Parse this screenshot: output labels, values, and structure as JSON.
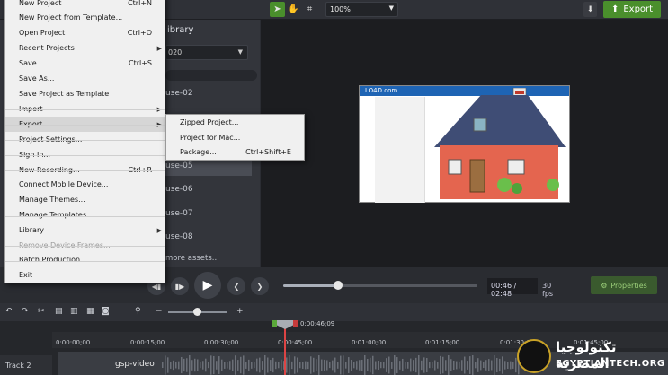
{
  "toolbar": {
    "zoom_value": "100%",
    "export_label": "Export"
  },
  "library": {
    "title": "Library",
    "title_visible": "ibrary",
    "select_value": "020",
    "items": [
      "use-02",
      "use-05",
      "use-06",
      "use-07",
      "use-08"
    ],
    "more_assets": "more assets..."
  },
  "file_menu": {
    "items": [
      {
        "label": "New Project",
        "shortcut": "Ctrl+N"
      },
      {
        "label": "New Project from Template...",
        "shortcut": ""
      },
      {
        "label": "Open Project",
        "shortcut": "Ctrl+O"
      },
      {
        "label": "Recent Projects",
        "shortcut": ""
      },
      {
        "label": "Save",
        "shortcut": "Ctrl+S"
      },
      {
        "label": "Save As...",
        "shortcut": ""
      },
      {
        "label": "Save Project as Template",
        "shortcut": ""
      },
      {
        "label": "Import",
        "shortcut": ""
      },
      {
        "label": "Export",
        "shortcut": ""
      },
      {
        "label": "Project Settings...",
        "shortcut": ""
      },
      {
        "label": "Sign In...",
        "shortcut": ""
      },
      {
        "label": "New Recording...",
        "shortcut": "Ctrl+R"
      },
      {
        "label": "Connect Mobile Device...",
        "shortcut": ""
      },
      {
        "label": "Manage Themes...",
        "shortcut": ""
      },
      {
        "label": "Manage Templates...",
        "shortcut": ""
      },
      {
        "label": "Library",
        "shortcut": ""
      },
      {
        "label": "Remove Device Frames...",
        "shortcut": ""
      },
      {
        "label": "Batch Production...",
        "shortcut": ""
      },
      {
        "label": "Exit",
        "shortcut": ""
      }
    ],
    "export_submenu": [
      {
        "label": "Zipped Project...",
        "shortcut": ""
      },
      {
        "label": "Project for Mac...",
        "shortcut": ""
      },
      {
        "label": "Package...",
        "shortcut": "Ctrl+Shift+E"
      }
    ]
  },
  "preview": {
    "site_logo": "LO4D.com"
  },
  "player": {
    "timecode": "00:46 / 02:48",
    "fps": "30 fps",
    "properties_label": "Properties",
    "progress": 0.274
  },
  "timeline": {
    "playhead_time": "0:00:46;09",
    "ticks": [
      "0:00:00;00",
      "0:00:15;00",
      "0:00:30;00",
      "0:00:45;00",
      "0:01:00;00",
      "0:01:15;00",
      "0:01:30;00",
      "0:01:45;00"
    ],
    "track_label": "Track 2",
    "clip_name": "gsp-video"
  },
  "watermark": {
    "arabic": "تكنولوجيا المصرية",
    "english": "EGYPTIANTECH.ORG"
  }
}
